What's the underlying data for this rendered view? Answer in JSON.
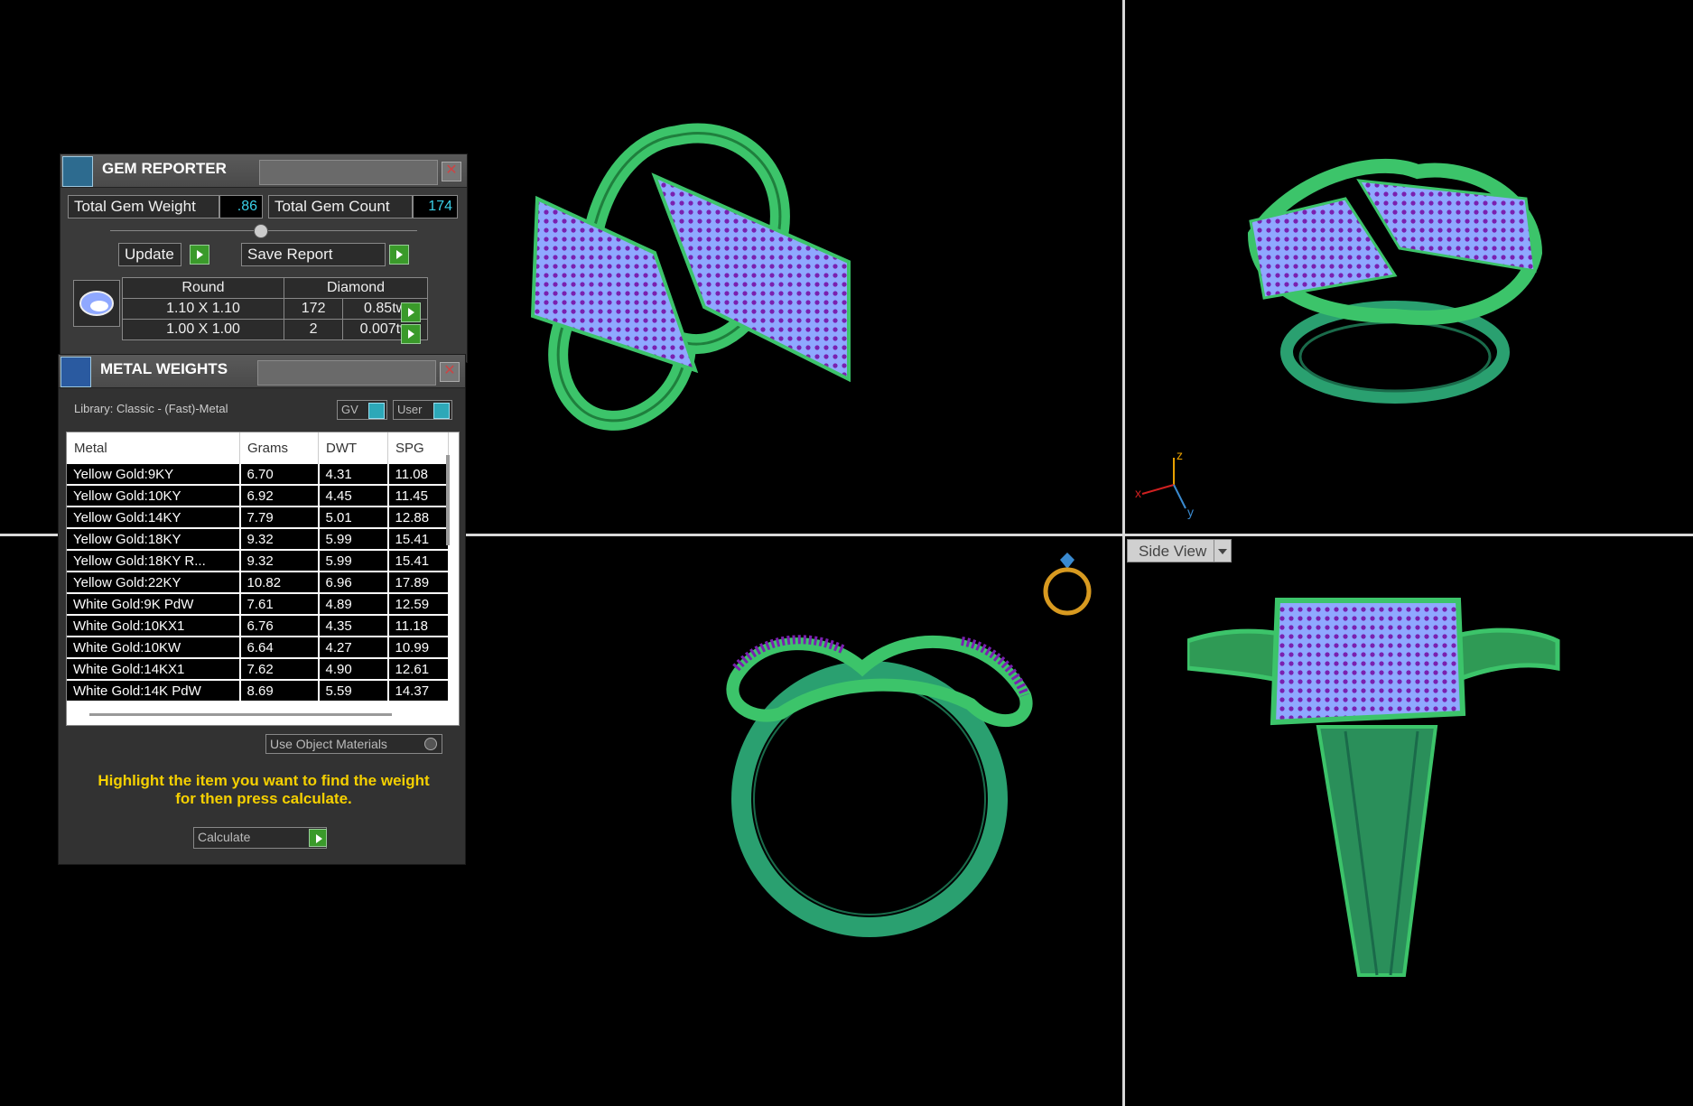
{
  "viewports": {
    "side_view_label": "Side View",
    "axis_labels": {
      "z": "z",
      "x": "x",
      "y": "y"
    }
  },
  "gem_reporter": {
    "title": "GEM REPORTER",
    "total_gem_weight_label": "Total Gem Weight",
    "total_gem_weight_value": ".86",
    "total_gem_count_label": "Total Gem Count",
    "total_gem_count_value": "174",
    "update_label": "Update",
    "save_report_label": "Save Report",
    "table_header": {
      "shape": "Round",
      "material": "Diamond"
    },
    "rows": [
      {
        "size": "1.10 X 1.10",
        "count": "172",
        "weight": "0.85tw"
      },
      {
        "size": "1.00 X 1.00",
        "count": "2",
        "weight": "0.007tw"
      }
    ]
  },
  "metal_weights": {
    "title": "METAL WEIGHTS",
    "library_label": "Library: Classic - (Fast)-Metal",
    "gv_label": "GV",
    "user_label": "User",
    "columns": [
      "Metal",
      "Grams",
      "DWT",
      "SPG"
    ],
    "rows": [
      {
        "metal": "Yellow Gold:9KY",
        "grams": "6.70",
        "dwt": "4.31",
        "spg": "11.08"
      },
      {
        "metal": "Yellow Gold:10KY",
        "grams": "6.92",
        "dwt": "4.45",
        "spg": "11.45"
      },
      {
        "metal": "Yellow Gold:14KY",
        "grams": "7.79",
        "dwt": "5.01",
        "spg": "12.88"
      },
      {
        "metal": "Yellow Gold:18KY",
        "grams": "9.32",
        "dwt": "5.99",
        "spg": "15.41"
      },
      {
        "metal": "Yellow Gold:18KY R...",
        "grams": "9.32",
        "dwt": "5.99",
        "spg": "15.41"
      },
      {
        "metal": "Yellow Gold:22KY",
        "grams": "10.82",
        "dwt": "6.96",
        "spg": "17.89"
      },
      {
        "metal": "White Gold:9K PdW",
        "grams": "7.61",
        "dwt": "4.89",
        "spg": "12.59"
      },
      {
        "metal": "White Gold:10KX1",
        "grams": "6.76",
        "dwt": "4.35",
        "spg": "11.18"
      },
      {
        "metal": "White Gold:10KW",
        "grams": "6.64",
        "dwt": "4.27",
        "spg": "10.99"
      },
      {
        "metal": "White Gold:14KX1",
        "grams": "7.62",
        "dwt": "4.90",
        "spg": "12.61"
      },
      {
        "metal": "White Gold:14K PdW",
        "grams": "8.69",
        "dwt": "5.59",
        "spg": "14.37"
      }
    ],
    "use_object_materials_label": "Use Object Materials",
    "hint_line1": "Highlight the item you want to find the weight",
    "hint_line2": "for then press calculate.",
    "calculate_label": "Calculate"
  },
  "colors": {
    "metal_green": "#3cc46a",
    "gem_blue": "#8fa8ff",
    "gem_purple": "#7a20b0",
    "hint_yellow": "#f5d000",
    "value_cyan": "#3ad0e8"
  }
}
